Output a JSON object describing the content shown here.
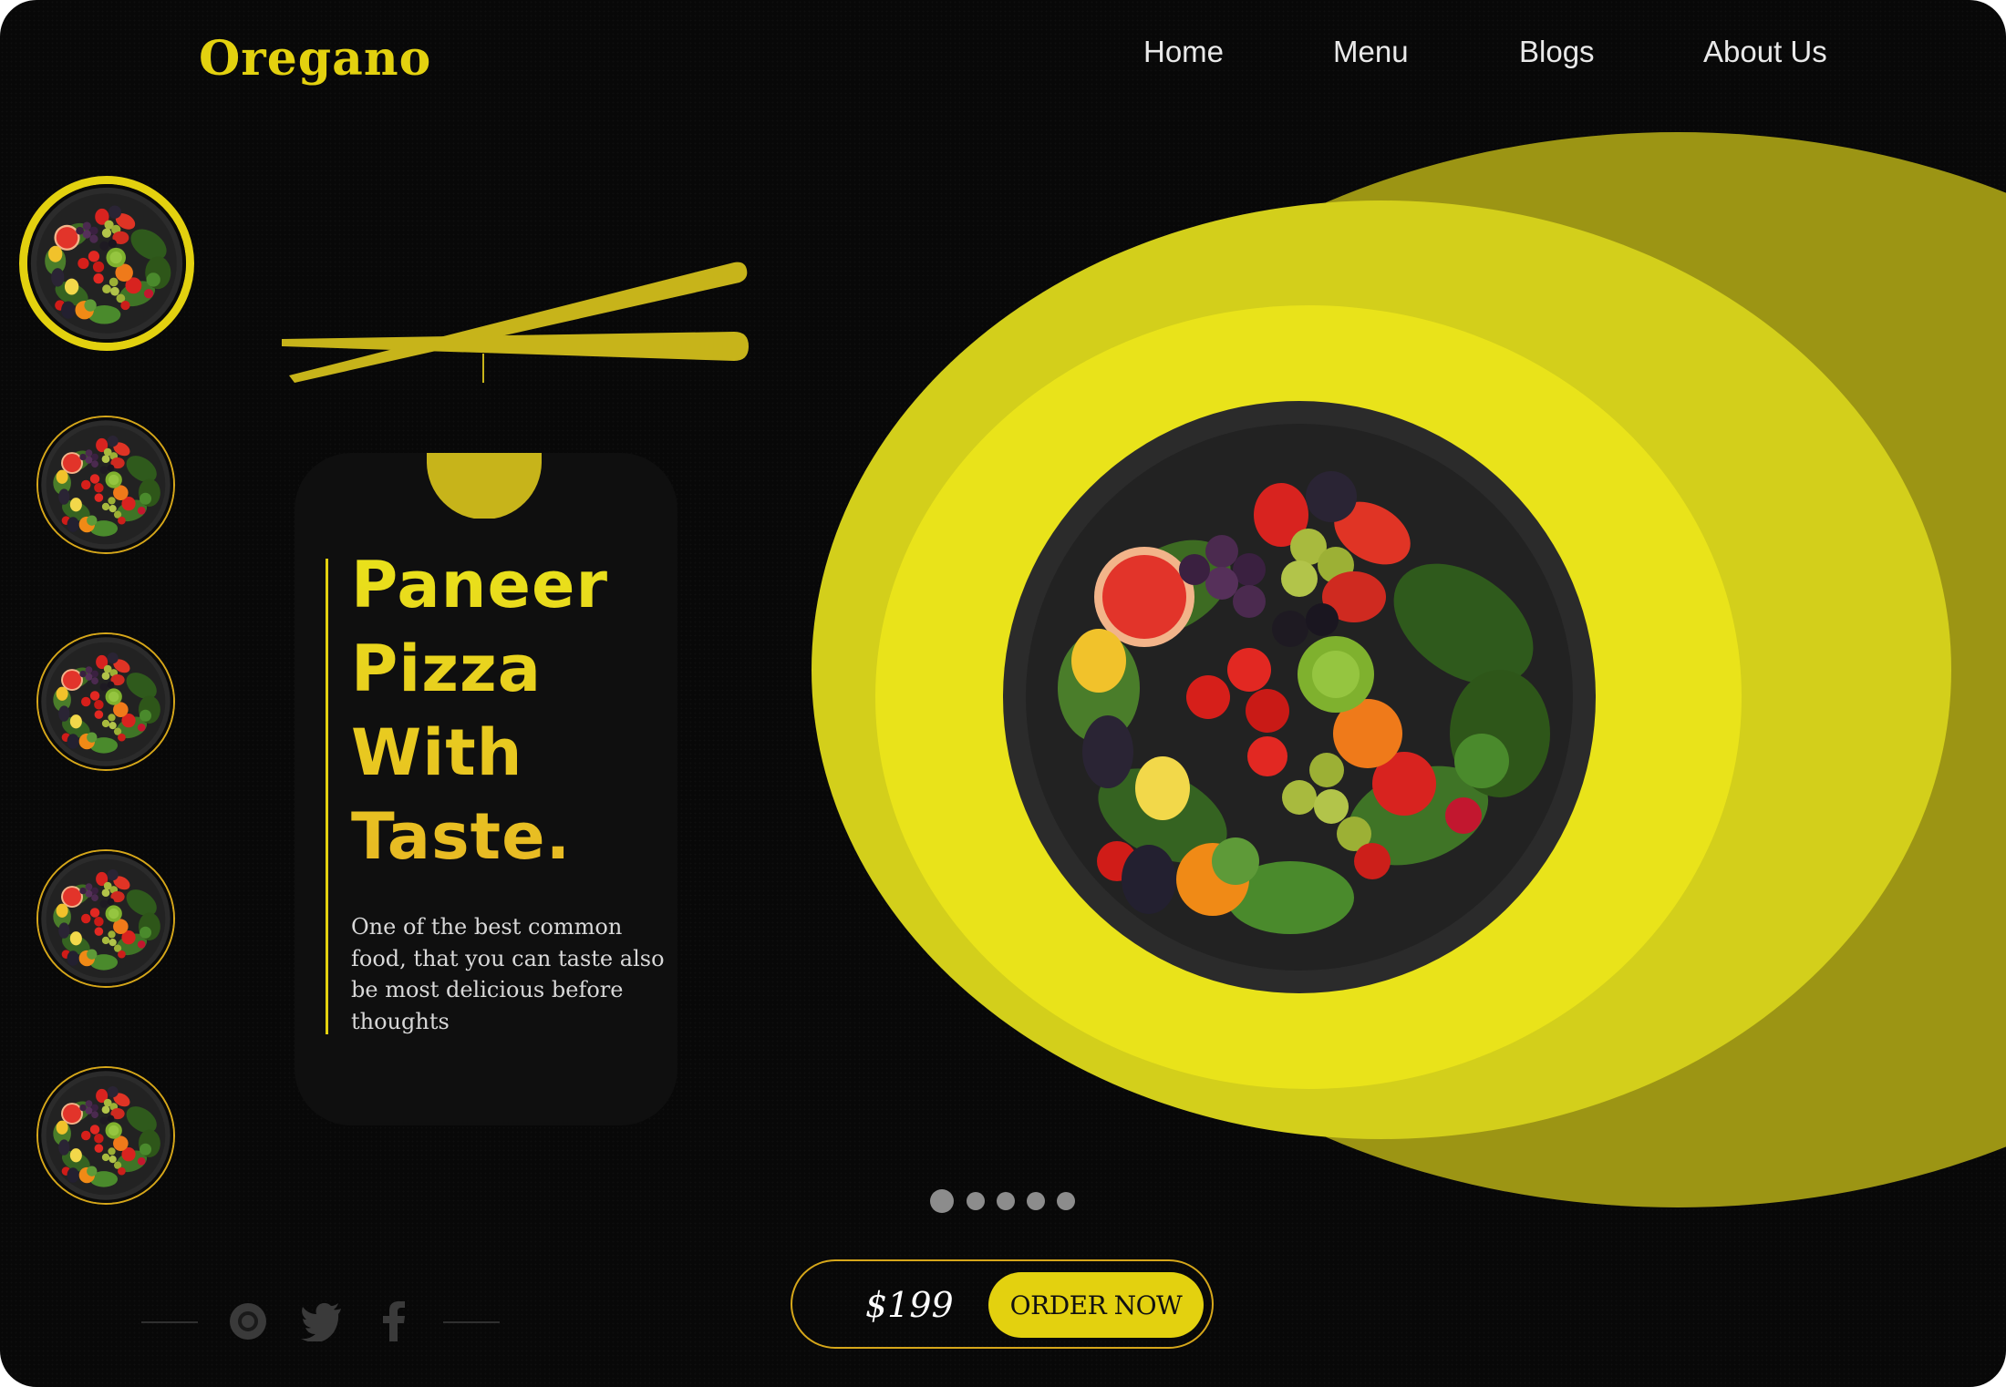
{
  "brand": {
    "logo": "Oregano",
    "accent": "#e3d10f"
  },
  "nav": {
    "items": [
      "Home",
      "Menu",
      "Blogs",
      "About Us"
    ]
  },
  "hero": {
    "title_lines": [
      "Paneer",
      "Pizza",
      "With",
      "Taste."
    ],
    "description": "One of the best common food, that you can taste also be most delicious before thoughts",
    "price": "$199",
    "order_label": "ORDER NOW"
  },
  "thumbnails": {
    "count": 5,
    "selected_index": 0
  },
  "pagination": {
    "count": 5,
    "active_index": 0
  },
  "social": {
    "icons": [
      "instagram-icon",
      "twitter-icon",
      "facebook-icon"
    ]
  },
  "colors": {
    "background": "#080808",
    "yellow_light": "#e9e31a",
    "yellow_mid": "#d3cf1b",
    "yellow_dark": "#9c9514",
    "gold": "#d6a71a"
  }
}
